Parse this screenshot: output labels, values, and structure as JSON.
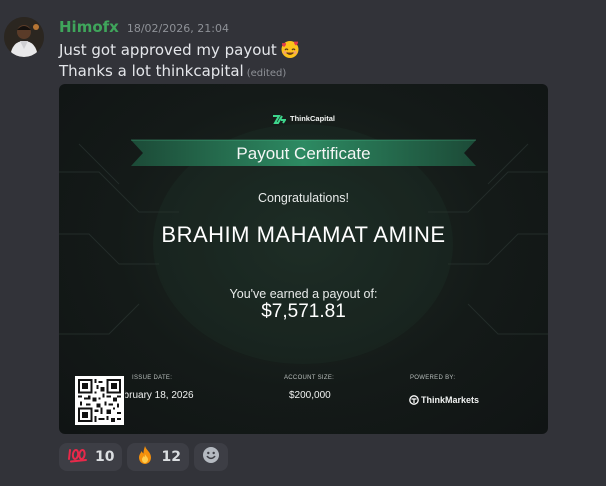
{
  "message": {
    "username": "Himofx",
    "timestamp": "18/02/2026, 21:04",
    "line1": "Just got approved my payout",
    "line2": "Thanks a lot thinkcapital",
    "edited_label": "(edited)"
  },
  "certificate": {
    "brand": "ThinkCapital",
    "title": "Payout Certificate",
    "congrats": "Congratulations!",
    "recipient": "BRAHIM MAHAMAT AMINE",
    "earned_text": "You've earned a payout of:",
    "amount": "$7,571.81",
    "issue_date_label": "ISSUE DATE:",
    "issue_date": "ebruary 18, 2026",
    "account_size_label": "ACCOUNT SIZE:",
    "account_size": "$200,000",
    "powered_by_label": "POWERED BY:",
    "powered_by": "ThinkMarkets"
  },
  "reactions": [
    {
      "emoji": "hundred-points-icon",
      "count": "10"
    },
    {
      "emoji": "fire-icon",
      "count": "12"
    }
  ],
  "colors": {
    "background": "#323339",
    "username": "#3fa55b",
    "accent_green": "#2f8f68"
  }
}
